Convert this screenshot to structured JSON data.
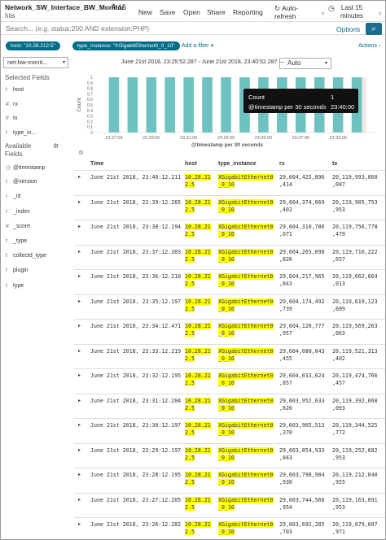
{
  "header": {
    "title": "Network_SW_Interface_BW_Monitor",
    "hits_count": "15",
    "hits_label": "hits",
    "menu": [
      "New",
      "Save",
      "Open",
      "Share",
      "Reporting"
    ],
    "auto_refresh_line1": "Auto-",
    "auto_refresh_line2": "refresh",
    "time_line1": "Last 15",
    "time_line2": "minutes"
  },
  "search": {
    "placeholder": "Search... (e.g. status:200 AND extension:PHP)",
    "options": "Options"
  },
  "filters": {
    "pills": [
      "host: \"10.28.212.5\"",
      "type_instance: \"XGigabitEthernet0_0_10\""
    ],
    "add_filter": "Add a filter",
    "actions": "Actions"
  },
  "sidebar": {
    "index_pattern": "net-bw-monit...",
    "selected_heading": "Selected Fields",
    "selected_fields": [
      {
        "type": "t",
        "name": "host"
      },
      {
        "type": "#",
        "name": "rx"
      },
      {
        "type": "#",
        "name": "tx"
      },
      {
        "type": "t",
        "name": "type_in..."
      }
    ],
    "available_heading_1": "Available",
    "available_heading_2": "Fields",
    "available_fields": [
      {
        "type": "◷",
        "name": "@timestamp"
      },
      {
        "type": "t",
        "name": "@version"
      },
      {
        "type": "t",
        "name": "_id"
      },
      {
        "type": "t",
        "name": "_index"
      },
      {
        "type": "#",
        "name": "_score"
      },
      {
        "type": "t",
        "name": "_type"
      },
      {
        "type": "t",
        "name": "collectd_type"
      },
      {
        "type": "t",
        "name": "plugin"
      },
      {
        "type": "t",
        "name": "type"
      }
    ]
  },
  "chart_toolbar": {
    "range": "June 21st 2018, 23:25:52.287 - June 21st 2018, 23:40:52.287 —",
    "interval": "Auto"
  },
  "chart_data": {
    "type": "bar",
    "ylabel": "Count",
    "xlabel": "@timestamp per 30 seconds",
    "ylim": [
      0,
      1
    ],
    "yticks": [
      "0",
      "0.1",
      "0.2",
      "0.3",
      "0.4",
      "0.5",
      "0.6",
      "0.7",
      "0.8",
      "0.9",
      "1"
    ],
    "xticks": [
      "23:27:00",
      "23:29:00",
      "23:31:00",
      "23:33:00",
      "23:35:00",
      "23:37:00",
      "23:39:00"
    ],
    "x": [
      "23:26:00",
      "23:26:30",
      "23:27:00",
      "23:27:30",
      "23:28:00",
      "23:28:30",
      "23:29:00",
      "23:29:30",
      "23:30:00",
      "23:30:30",
      "23:31:00",
      "23:31:30",
      "23:32:00",
      "23:32:30",
      "23:33:00",
      "23:33:30",
      "23:34:00",
      "23:34:30",
      "23:35:00",
      "23:35:30",
      "23:36:00",
      "23:36:30",
      "23:37:00",
      "23:37:30",
      "23:38:00",
      "23:38:30",
      "23:39:00",
      "23:39:30",
      "23:40:00",
      "23:40:30"
    ],
    "values": [
      0,
      0,
      1,
      0,
      1,
      0,
      1,
      0,
      1,
      0,
      1,
      0,
      1,
      0,
      1,
      0,
      1,
      0,
      1,
      0,
      1,
      0,
      1,
      0,
      1,
      0,
      1,
      0,
      1,
      0
    ],
    "bar_color": "#6ec3c0",
    "highlight_color": "#f1e7e7",
    "highlight_index": 28
  },
  "tooltip": {
    "label1": "Count",
    "value1": "1",
    "label2": "@timestamp per 30 seconds",
    "value2": "23:40:00"
  },
  "table": {
    "headers": [
      "Time",
      "host",
      "type_instance",
      "rx",
      "tx"
    ],
    "rows": [
      {
        "time": "June 21st 2018, 23:40:12.211",
        "host": [
          "10.28.21",
          "2.5"
        ],
        "type": [
          "XGigabitEthernet0",
          "_0_10"
        ],
        "rx": [
          "29,604,425,896",
          ",414"
        ],
        "tx": [
          "20,119,993,060",
          ",007"
        ]
      },
      {
        "time": "June 21st 2018, 23:39:12.265",
        "host": [
          "10.28.21",
          "2.5"
        ],
        "type": [
          "XGigabitEthernet0",
          "_0_10"
        ],
        "rx": [
          "29,604,374,069",
          ",402"
        ],
        "tx": [
          "20,119,905,753",
          ",953"
        ]
      },
      {
        "time": "June 21st 2018, 23:38:12.194",
        "host": [
          "10.28.21",
          "2.5"
        ],
        "type": [
          "XGigabitEthernet0",
          "_0_10"
        ],
        "rx": [
          "29,604,310,706",
          ",071"
        ],
        "tx": [
          "20,119,756,778",
          ",479"
        ]
      },
      {
        "time": "June 21st 2018, 23:37:12.303",
        "host": [
          "10.28.21",
          "2.5"
        ],
        "type": [
          "XGigabitEthernet0",
          "_0_10"
        ],
        "rx": [
          "29,604,265,098",
          ",826"
        ],
        "tx": [
          "20,119,710,222",
          ",657"
        ]
      },
      {
        "time": "June 21st 2018, 23:36:12.210",
        "host": [
          "10.28.21",
          "2.5"
        ],
        "type": [
          "XGigabitEthernet0",
          "_0_10"
        ],
        "rx": [
          "29,604,217,965",
          ",843"
        ],
        "tx": [
          "20,119,662,664",
          ",013"
        ]
      },
      {
        "time": "June 21st 2018, 23:35:12.197",
        "host": [
          "10.28.21",
          "2.5"
        ],
        "type": [
          "XGigabitEthernet0",
          "_0_10"
        ],
        "rx": [
          "29,604,174,492",
          ",739"
        ],
        "tx": [
          "20,119,619,123",
          ",609"
        ]
      },
      {
        "time": "June 21st 2018, 23:34:12.471",
        "host": [
          "10.28.21",
          "2.5"
        ],
        "type": [
          "XGigabitEthernet0",
          "_0_10"
        ],
        "rx": [
          "29,604,126,777",
          ",957"
        ],
        "tx": [
          "20,119,569,263",
          ",063"
        ]
      },
      {
        "time": "June 21st 2018, 23:33:12.219",
        "host": [
          "10.28.21",
          "2.5"
        ],
        "type": [
          "XGigabitEthernet0",
          "_0_10"
        ],
        "rx": [
          "29,604,080,043",
          ",455"
        ],
        "tx": [
          "20,119,521,313",
          ",402"
        ]
      },
      {
        "time": "June 21st 2018, 23:32:12.195",
        "host": [
          "10.28.21",
          "2.5"
        ],
        "type": [
          "XGigabitEthernet0",
          "_0_10"
        ],
        "rx": [
          "29,604,033,624",
          ",857"
        ],
        "tx": [
          "20,119,474,766",
          ",457"
        ]
      },
      {
        "time": "June 21st 2018, 23:31:12.204",
        "host": [
          "10.28.21",
          "2.5"
        ],
        "type": [
          "XGigabitEthernet0",
          "_0_10"
        ],
        "rx": [
          "29,603,952,633",
          ",626"
        ],
        "tx": [
          "20,119,392,668",
          ",093"
        ]
      },
      {
        "time": "June 21st 2018, 23:30:12.197",
        "host": [
          "10.28.21",
          "2.5"
        ],
        "type": [
          "XGigabitEthernet0",
          "_0_10"
        ],
        "rx": [
          "29,603,905,513",
          ",370"
        ],
        "tx": [
          "20,119,344,525",
          ",772"
        ]
      },
      {
        "time": "June 21st 2018, 23:29:12.197",
        "host": [
          "10.28.21",
          "2.5"
        ],
        "type": [
          "XGigabitEthernet0",
          "_0_10"
        ],
        "rx": [
          "29,603,854,933",
          ",843"
        ],
        "tx": [
          "20,119,252,682",
          ",953"
        ]
      },
      {
        "time": "June 21st 2018, 23:28:12.195",
        "host": [
          "10.28.21",
          "2.5"
        ],
        "type": [
          "XGigabitEthernet0",
          "_0_10"
        ],
        "rx": [
          "29,603,798,904",
          ",930"
        ],
        "tx": [
          "20,119,212,840",
          ",955"
        ]
      },
      {
        "time": "June 21st 2018, 23:27:12.205",
        "host": [
          "10.28.21",
          "2.5"
        ],
        "type": [
          "XGigabitEthernet0",
          "_0_10"
        ],
        "rx": [
          "29,603,744,566",
          ",954"
        ],
        "tx": [
          "20,119,163,091",
          ",953"
        ]
      },
      {
        "time": "June 21st 2018, 23:26:12.202",
        "host": [
          "10.28.21",
          "2.5"
        ],
        "type": [
          "XGigabitEthernet0",
          "_0_10"
        ],
        "rx": [
          "29,603,692,285",
          ",703"
        ],
        "tx": [
          "20,119,079,607",
          ",971"
        ]
      }
    ]
  },
  "icons": {
    "refresh": "↻",
    "auto_refresh": "↻",
    "calendar": "◷",
    "prev": "‹",
    "next": "›",
    "search": "⌕",
    "gear": "⚙",
    "collapse": "⊜",
    "expand": "▸",
    "caret": "▾",
    "plus": "+"
  }
}
